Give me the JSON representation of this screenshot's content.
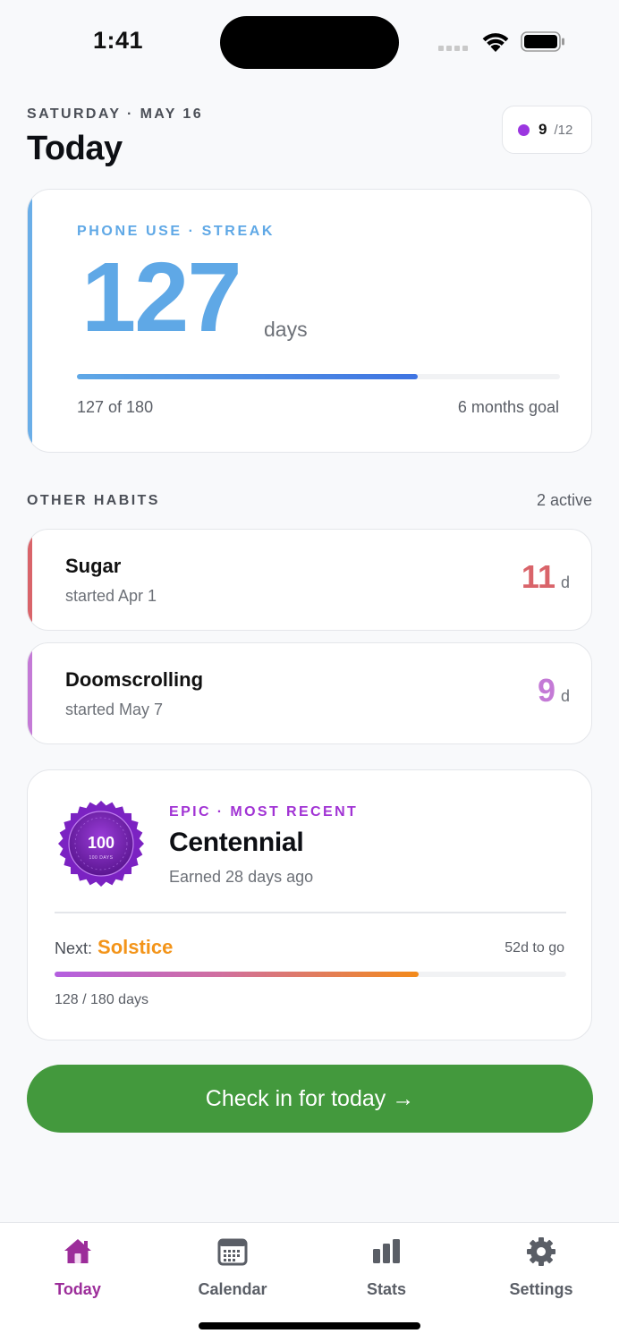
{
  "status_bar": {
    "time": "1:41"
  },
  "header": {
    "date": "SATURDAY · MAY 16",
    "title": "Today",
    "points": "9",
    "points_total": "/12",
    "points_color": "#9b36e0"
  },
  "main_habit": {
    "label": "PHONE USE · STREAK",
    "days": "127",
    "unit": "days",
    "progress_text": "127 of 180",
    "goal_text": "6 months goal",
    "progress_value": 127,
    "progress_max": 180,
    "accent_color": "#5fa8e6"
  },
  "other_habits": {
    "label": "OTHER HABITS",
    "count": "2 active",
    "items": [
      {
        "name": "Sugar",
        "started": "started Apr 1",
        "days": "11",
        "unit": "d",
        "color": "#d9646a"
      },
      {
        "name": "Doomscrolling",
        "started": "started May 7",
        "days": "9",
        "unit": "d",
        "color": "#c47ad6"
      }
    ]
  },
  "badge": {
    "tag": "EPIC · MOST RECENT",
    "title": "Centennial",
    "earned": "Earned 28 days ago",
    "medal_number": "100",
    "medal_caption": "100 DAYS",
    "next_label": "Next:",
    "next_name": "Solstice",
    "next_togo": "52d to go",
    "next_progress": "128 / 180 days",
    "next_value": 128,
    "next_max": 180
  },
  "checkin": {
    "label": "Check in for today →"
  },
  "tabs": [
    {
      "label": "Today",
      "icon": "home-icon",
      "active": true
    },
    {
      "label": "Calendar",
      "icon": "calendar-icon",
      "active": false
    },
    {
      "label": "Stats",
      "icon": "bar-chart-icon",
      "active": false
    },
    {
      "label": "Settings",
      "icon": "gear-icon",
      "active": false
    }
  ],
  "colors": {
    "accent_purple": "#9c2d9a",
    "checkin_green": "#43993d",
    "next_orange": "#f39419"
  }
}
